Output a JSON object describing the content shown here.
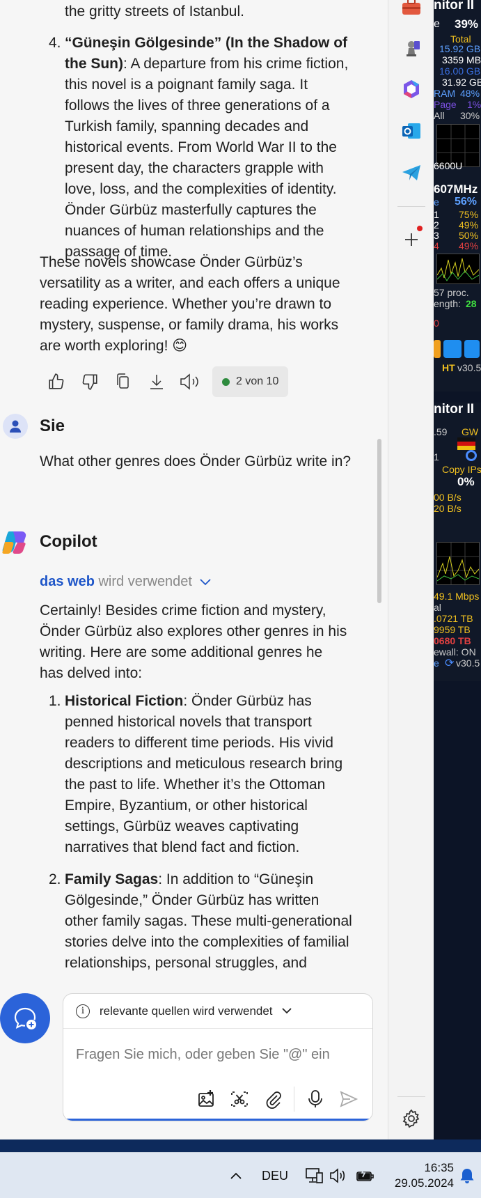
{
  "prev_response": {
    "top_line": "the gritty streets of Istanbul.",
    "item4_num": "4.",
    "item4_title": "“Güneşin Gölgesinde” (In the Shadow of the Sun)",
    "item4_text": ": A departure from his crime fiction, this novel is a poignant family saga. It follows the lives of three generations of a Turkish family, spanning decades and historical events. From World War II to the present day, the characters grapple with love, loss, and the complexities of identity. Önder Gürbüz masterfully captures the nuances of human relationships and the passage of time.",
    "closing": "These novels showcase Önder Gürbüz’s versatility as a writer, and each offers a unique reading experience. Whether you’re drawn to mystery, suspense, or family drama, his works are worth exploring! 😊"
  },
  "actions": {
    "pager": "2 von 10",
    "icons": [
      "thumbs-up-icon",
      "thumbs-down-icon",
      "copy-icon",
      "download-icon",
      "speaker-icon"
    ]
  },
  "user_msg": {
    "author": "Sie",
    "text": "What other genres does Önder Gürbüz write in?"
  },
  "copilot": {
    "author": "Copilot",
    "web_link": "das web",
    "web_suffix": "wird verwendet",
    "intro": "Certainly! Besides crime fiction and mystery, Önder Gürbüz also explores other genres in his writing. Here are some additional genres he has delved into:",
    "items": [
      {
        "num": "1.",
        "title": "Historical Fiction",
        "text": ": Önder Gürbüz has penned historical novels that transport readers to different time periods. His vivid descriptions and meticulous research bring the past to life. Whether it’s the Ottoman Empire, Byzantium, or other historical settings, Gürbüz weaves captivating narratives that blend fact and fiction."
      },
      {
        "num": "2.",
        "title": "Family Sagas",
        "text": ": In addition to “Güneşin Gölgesinde,” Önder Gürbüz has written other family sagas. These multi-generational stories delve into the complexities of familial relationships, personal struggles, and"
      }
    ]
  },
  "compose": {
    "sources_label": "relevante quellen wird verwendet",
    "placeholder": "Fragen Sie mich, oder geben Sie \"@\" ein"
  },
  "monitor": {
    "top": [
      "nitor II",
      "e",
      "39%",
      "Total",
      "15.92 GB",
      "3359 MB",
      "16.00 GB",
      "31.92 GB",
      "RAM",
      "48%",
      "Page",
      "1%",
      "All",
      "30%",
      "6600U",
      "607MHz",
      "e",
      "56%",
      "1",
      "75%",
      "2",
      "49%",
      "3",
      "50%",
      "4",
      "49%",
      "57 proc.",
      "ength:",
      "28",
      "0",
      "HT",
      "v30.5"
    ],
    "bottom": [
      "nitor II",
      ".59",
      "GW",
      "1",
      "Copy IPs",
      "0%",
      "00 B/s",
      "20 B/s",
      "49.1 Mbps",
      "al",
      ".0721 TB",
      "9959 TB",
      "0680 TB",
      "ewall: ON",
      "e",
      "v30.5"
    ]
  },
  "taskbar": {
    "language": "DEU",
    "time": "16:35",
    "date": "29.05.2024"
  }
}
